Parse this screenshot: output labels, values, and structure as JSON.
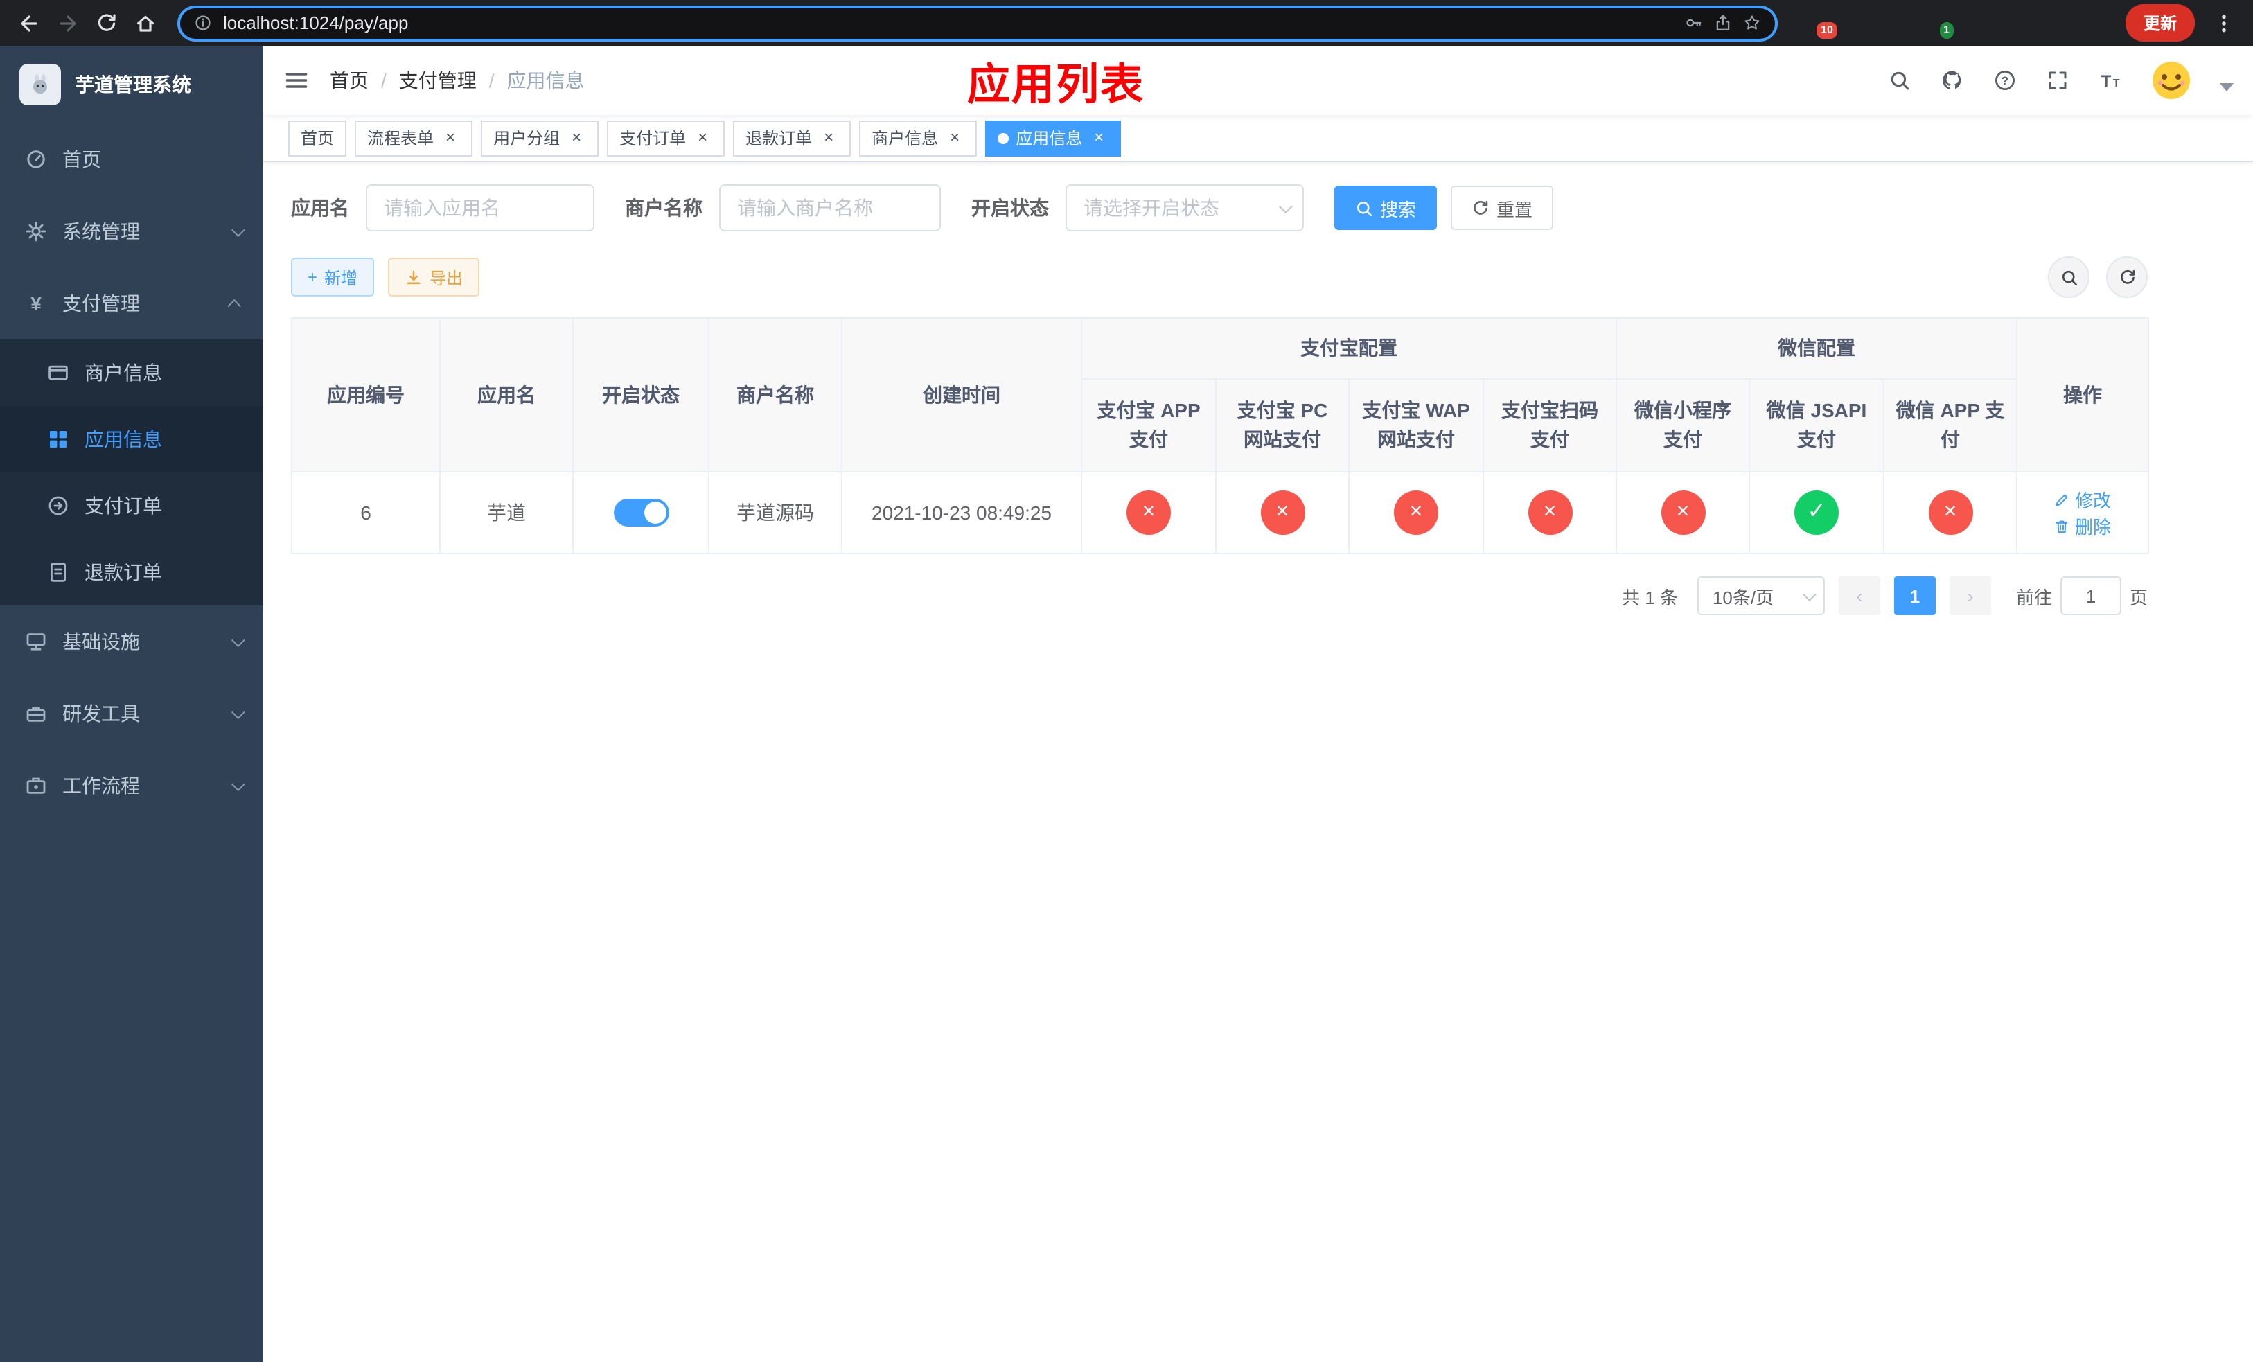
{
  "colors": {
    "accent": "#409eff",
    "success": "#13ce66",
    "danger": "#f7564d",
    "warning": "#e6a23c",
    "banner_red": "#fb0000",
    "sidebar_bg": "#304156",
    "submenu_bg": "#1f2d3d"
  },
  "icons": {
    "plus": "+",
    "close": "×",
    "check": "✓",
    "cross": "×",
    "prev": "‹",
    "next": "›",
    "yen": "¥",
    "slash": "/"
  },
  "browser": {
    "url": "localhost:1024/pay/app",
    "update_label": "更新",
    "ext_badge_red": "10",
    "ext_badge_green": "1"
  },
  "sidebar": {
    "logo_title": "芋道管理系统",
    "menu": [
      {
        "label": "首页"
      },
      {
        "label": "系统管理"
      },
      {
        "label": "支付管理",
        "children": [
          {
            "label": "商户信息"
          },
          {
            "label": "应用信息",
            "active": true
          },
          {
            "label": "支付订单"
          },
          {
            "label": "退款订单"
          }
        ]
      },
      {
        "label": "基础设施"
      },
      {
        "label": "研发工具"
      },
      {
        "label": "工作流程"
      }
    ]
  },
  "navbar": {
    "breadcrumb": [
      "首页",
      "支付管理",
      "应用信息"
    ],
    "page_banner": "应用列表"
  },
  "tabs": [
    {
      "label": "首页",
      "active": false
    },
    {
      "label": "流程表单",
      "active": false
    },
    {
      "label": "用户分组",
      "active": false
    },
    {
      "label": "支付订单",
      "active": false
    },
    {
      "label": "退款订单",
      "active": false
    },
    {
      "label": "商户信息",
      "active": false
    },
    {
      "label": "应用信息",
      "active": true
    }
  ],
  "filters": {
    "app_name_label": "应用名",
    "app_name_placeholder": "请输入应用名",
    "merchant_label": "商户名称",
    "merchant_placeholder": "请输入商户名称",
    "status_label": "开启状态",
    "status_placeholder": "请选择开启状态",
    "search_label": "搜索",
    "reset_label": "重置"
  },
  "toolbar": {
    "add_label": "新增",
    "export_label": "导出"
  },
  "table": {
    "headers": {
      "app_id": "应用编号",
      "app_name": "应用名",
      "status": "开启状态",
      "merchant": "商户名称",
      "create_time": "创建时间",
      "alipay_group": "支付宝配置",
      "wechat_group": "微信配置",
      "alipay_app": "支付宝 APP 支付",
      "alipay_pc": "支付宝 PC 网站支付",
      "alipay_wap": "支付宝 WAP 网站支付",
      "alipay_qr": "支付宝扫码支付",
      "wx_mini": "微信小程序支付",
      "wx_jsapi": "微信 JSAPI 支付",
      "wx_app": "微信 APP 支付",
      "actions": "操作"
    },
    "rows": [
      {
        "app_id": "6",
        "app_name": "芋道",
        "enabled": true,
        "merchant": "芋道源码",
        "create_time": "2021-10-23 08:49:25",
        "alipay_app": false,
        "alipay_pc": false,
        "alipay_wap": false,
        "alipay_qr": false,
        "wx_mini": false,
        "wx_jsapi": true,
        "wx_app": false,
        "edit_label": "修改",
        "delete_label": "删除"
      }
    ]
  },
  "pagination": {
    "total_text": "共 1 条",
    "page_size": "10条/页",
    "current_page": "1",
    "goto_prefix": "前往",
    "goto_value": "1",
    "goto_suffix": "页"
  }
}
